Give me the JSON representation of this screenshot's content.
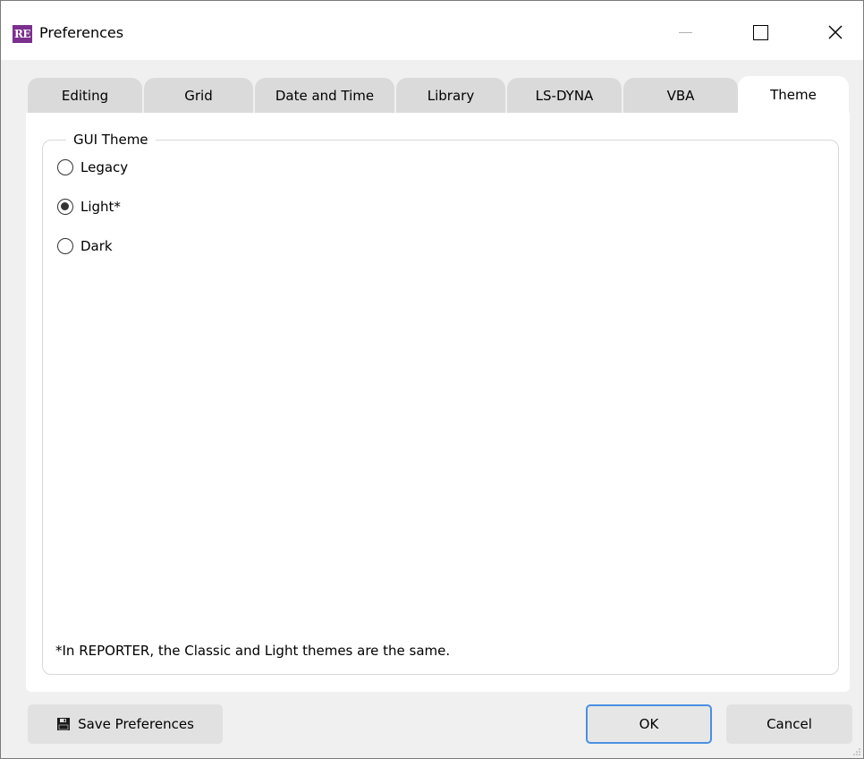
{
  "window": {
    "title": "Preferences",
    "app_icon_text": "RE",
    "icons": {
      "app": "reporter-app-icon",
      "minimize": "minimize-icon",
      "maximize": "maximize-icon",
      "close": "close-icon"
    }
  },
  "tabs": [
    {
      "label": "Editing",
      "active": false
    },
    {
      "label": "Grid",
      "active": false
    },
    {
      "label": "Date and Time",
      "active": false
    },
    {
      "label": "Library",
      "active": false
    },
    {
      "label": "LS-DYNA",
      "active": false
    },
    {
      "label": "VBA",
      "active": false
    },
    {
      "label": "Theme",
      "active": true
    }
  ],
  "theme_panel": {
    "group_title": "GUI Theme",
    "options": [
      {
        "label": "Legacy",
        "checked": false
      },
      {
        "label": "Light*",
        "checked": true
      },
      {
        "label": "Dark",
        "checked": false
      }
    ],
    "note": "*In REPORTER, the Classic and Light themes are the same."
  },
  "footer": {
    "save_label": "Save Preferences",
    "save_icon": "floppy-disk-icon",
    "ok_label": "OK",
    "cancel_label": "Cancel"
  },
  "colors": {
    "app_icon_bg": "#7b2f8e",
    "focus_border": "#4a90e2",
    "inactive_tab": "#dadada"
  }
}
